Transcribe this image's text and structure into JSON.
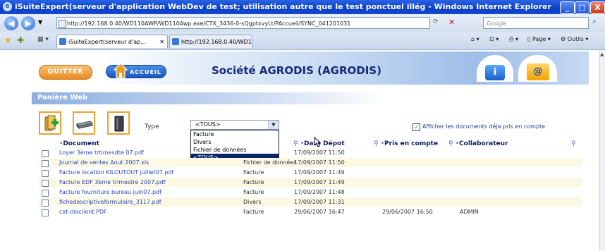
{
  "window": {
    "title": "iSuiteExpert(serveur d'application WebDev de test; utilisation autre que le test ponctuel illég - Windows Internet Explorer",
    "minimize": "_",
    "maximize": "□",
    "close": "X"
  },
  "address_bar": {
    "url": "http://192.168.0.40/WD110AWP/WD110Awp.exe/CTX_3436-0-sQgptxvyLt/PAccueil/SYNC_041201031",
    "search_placeholder": "Google"
  },
  "tabs": [
    {
      "label": "iSuiteExpert(serveur d'ap...",
      "active": true
    },
    {
      "label": "http://192.168.0.40/WD110...",
      "active": false
    }
  ],
  "toolbar_right": {
    "page": "Page",
    "tools": "Outils"
  },
  "app": {
    "quit_label": "QUITTER",
    "home_label": "ACCUEIL",
    "company": "Société AGRODIS (AGRODIS)",
    "info_glyph": "i",
    "mail_glyph": "@"
  },
  "section_title": "Panière Web",
  "filter": {
    "type_label": "Type",
    "selected": "<TOUS>",
    "options": [
      "Facture",
      "Divers",
      "Fichier de données",
      "<TOUS>"
    ],
    "show_taken_label": "Afficher les documents déja pris en compte",
    "show_taken_checked": true
  },
  "table": {
    "headers": {
      "document": "Document",
      "date_depot": "Date Dépot",
      "pris_en_compte": "Pris en compte",
      "collaborateur": "Collaborateur"
    },
    "rows": [
      {
        "document": "Loyer 3ème trtimesdte 07.pdf",
        "type": "",
        "date_depot": "17/09/2007 11:50",
        "pris": "",
        "collab": ""
      },
      {
        "document": "Journal de ventes Aout 2007.xls",
        "type": "Fichier de données",
        "date_depot": "17/09/2007 11:50",
        "pris": "",
        "collab": ""
      },
      {
        "document": "Facture location KILOUTOUT juillet07.pdf",
        "type": "Facture",
        "date_depot": "17/09/2007 11:49",
        "pris": "",
        "collab": ""
      },
      {
        "document": "Facture EDF 3ème trimestre 2007.pdf",
        "type": "Facture",
        "date_depot": "17/09/2007 11:49",
        "pris": "",
        "collab": ""
      },
      {
        "document": "Facture fourniture bureau juin07.pdf",
        "type": "Facture",
        "date_depot": "17/09/2007 11:48",
        "pris": "",
        "collab": ""
      },
      {
        "document": "fichedescriptiveformulaire_3117.pdf",
        "type": "Divers",
        "date_depot": "17/09/2007 11:31",
        "pris": "",
        "collab": ""
      },
      {
        "document": "cat-diaclient.PDF",
        "type": "Facture",
        "date_depot": "29/06/2007 16:47",
        "pris": "29/06/2007 16:50",
        "collab": "ADMIN"
      }
    ]
  }
}
